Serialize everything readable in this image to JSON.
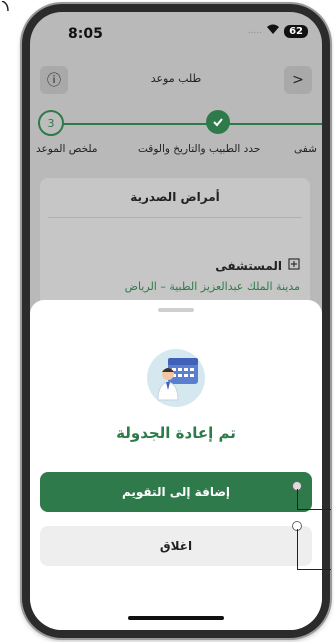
{
  "status_bar": {
    "time": "8:05",
    "signal": ".....",
    "wifi": "wifi",
    "battery": "62"
  },
  "header": {
    "title": "طلب موعد",
    "info_icon": "ⓘ",
    "back_icon": ">"
  },
  "stepper": {
    "step3_number": "3",
    "steps": [
      {
        "label": "ملخص الموعد"
      },
      {
        "label": "حدد الطبيب والتاريخ والوقت"
      },
      {
        "label": "شفى"
      }
    ]
  },
  "card": {
    "title": "أمراض الصدرية",
    "hospital_label": "المستشفى",
    "hospital_value": "مدينة الملك عبدالعزيز الطبية – الرياض"
  },
  "sheet": {
    "title": "تم إعادة الجدولة",
    "add_to_calendar": "إضافة إلى التقويم",
    "close": "اغلاق"
  },
  "colors": {
    "primary": "#2f7a4a",
    "overlay": "#b9b9b9"
  }
}
